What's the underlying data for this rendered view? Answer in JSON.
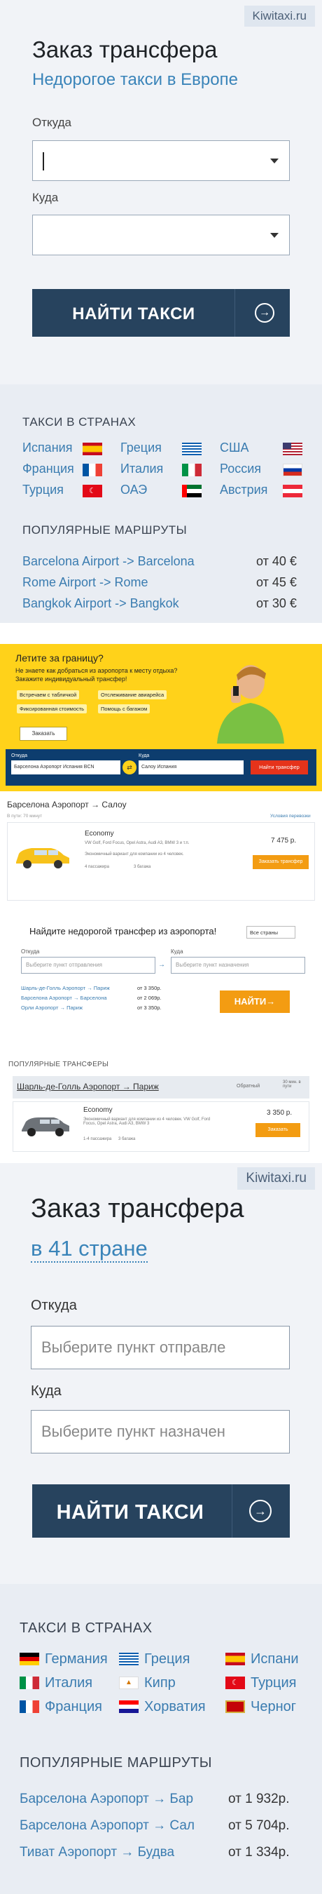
{
  "widget1": {
    "brand": "Kiwitaxi.ru",
    "title": "Заказ трансфера",
    "subtitle": "Недорогое такси в Европе",
    "from_label": "Откуда",
    "to_label": "Куда",
    "find_button": "НАЙТИ ТАКСИ",
    "countries_heading": "ТАКСИ В СТРАНАХ",
    "countries": [
      "Испания",
      "Греция",
      "США",
      "Франция",
      "Италия",
      "Россия",
      "Турция",
      "ОАЭ",
      "Австрия"
    ],
    "routes_heading": "ПОПУЛЯРНЫЕ МАРШРУТЫ",
    "routes": [
      {
        "route": "Barcelona Airport -> Barcelona",
        "price": "от 40 €"
      },
      {
        "route": "Rome Airport -> Rome",
        "price": "от 45 €"
      },
      {
        "route": "Bangkok Airport -> Bangkok",
        "price": "от 30 €"
      }
    ]
  },
  "banner": {
    "title": "Летите за границу?",
    "text": "Не знаете как добраться из аэропорта к месту отдыха? Закажите индивидуальный трансфер!",
    "features": [
      "Встречаем с табличкой",
      "Отслеживание авиарейса",
      "Фиксированная стоимость",
      "Помощь с багажом"
    ],
    "order_button": "Заказать",
    "from_label": "Откуда",
    "from_value": "Барселона Аэропорт Испания BCN",
    "to_label": "Куда",
    "to_value": "Салоу Испания",
    "search_button": "Найти трансфер"
  },
  "widget2": {
    "title": "Барселона Аэропорт → Салоу",
    "subtitle": "В пути: 70 минут",
    "link": "Условия перевозки",
    "car_class": "Economy",
    "car_models": "VW Golf, Ford Focus, Opel Astra, Audi A3, BMW 3 и т.п.",
    "car_desc": "Экономичный вариант для компании из 4 человек.",
    "passengers": "4 пассажира",
    "bags": "3 багажа",
    "price": "7 475 р.",
    "order_button": "Заказать трансфер"
  },
  "widget3": {
    "title": "Найдите недорогой трансфер из аэропорта!",
    "country_select": "Все страны",
    "from_label": "Откуда",
    "from_placeholder": "Выберите пункт отправления",
    "to_label": "Куда",
    "to_placeholder": "Выберите пункт назначения",
    "find_button": "НАЙТИ→",
    "routes": [
      {
        "route": "Шарль-де-Голль Аэропорт → Париж",
        "price": "от 3 350р."
      },
      {
        "route": "Барселона Аэропорт → Барселона",
        "price": "от 2 069р."
      },
      {
        "route": "Орли Аэропорт → Париж",
        "price": "от 3 350р."
      }
    ],
    "popular_heading": "ПОПУЛЯРНЫЕ ТРАНСФЕРЫ",
    "popular_route": "Шарль-де-Голль Аэропорт → Париж",
    "popular_option": "Обратный",
    "popular_time": "30 мин. в пути",
    "car_class": "Economy",
    "car_desc": "Экономичный вариант для компании из 4 человек. VW Golf, Ford Focus, Opel Astra, Audi A3, BMW 3",
    "passengers": "1-4 пассажира",
    "bags": "3 багажа",
    "price": "3 350 р.",
    "order_button": "Заказать"
  },
  "widget4": {
    "brand": "Kiwitaxi.ru",
    "title": "Заказ трансфера",
    "subtitle": "в 41 стране",
    "from_label": "Откуда",
    "from_placeholder": "Выберите пункт отправле",
    "to_label": "Куда",
    "to_placeholder": "Выберите пункт назначен",
    "find_button": "НАЙТИ ТАКСИ",
    "countries_heading": "ТАКСИ В СТРАНАХ",
    "countries": [
      "Германия",
      "Греция",
      "Испани",
      "Италия",
      "Кипр",
      "Турция",
      "Франция",
      "Хорватия",
      "Черног"
    ],
    "routes_heading": "ПОПУЛЯРНЫЕ МАРШРУТЫ",
    "routes": [
      {
        "route": "Барселона Аэропорт → Бар",
        "price": "от 1 932р."
      },
      {
        "route": "Барселона Аэропорт → Сал",
        "price": "от 5 704р."
      },
      {
        "route": "Тиват Аэропорт → Будва",
        "price": "от 1 334р."
      }
    ]
  },
  "colors": {
    "accent": "#3a7cb0",
    "button": "#27435e",
    "banner": "#ffd21a",
    "orange": "#f39c12"
  }
}
